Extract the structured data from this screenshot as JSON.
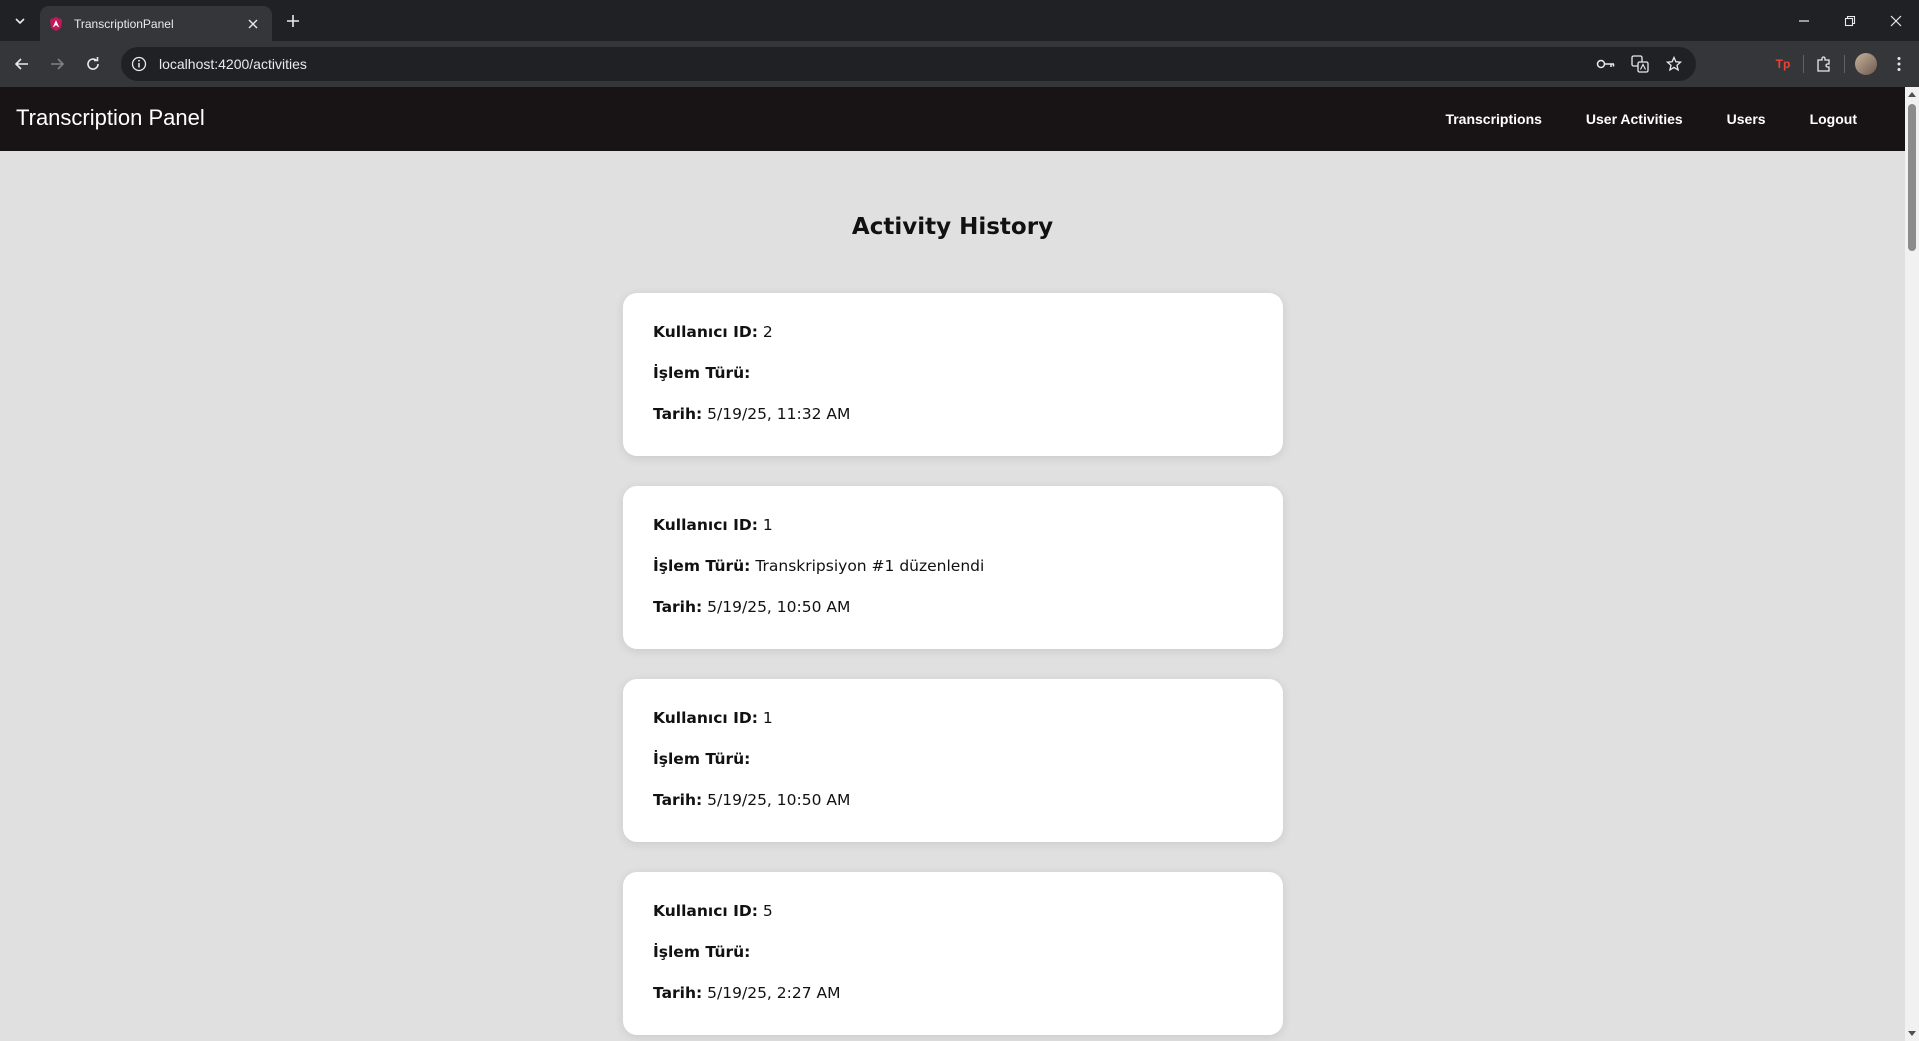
{
  "browser": {
    "tab_title": "TranscriptionPanel",
    "url": "localhost:4200/activities",
    "extension_badge": "Tp"
  },
  "header": {
    "brand": "Transcription Panel",
    "nav": [
      "Transcriptions",
      "User Activities",
      "Users",
      "Logout"
    ]
  },
  "page": {
    "title": "Activity History",
    "labels": {
      "user_id": "Kullanıcı ID:",
      "action_type": "İşlem Türü:",
      "date": "Tarih:"
    },
    "activities": [
      {
        "user_id": "2",
        "action_type": "",
        "date": "5/19/25, 11:32 AM"
      },
      {
        "user_id": "1",
        "action_type": "Transkripsiyon #1 düzenlendi",
        "date": "5/19/25, 10:50 AM"
      },
      {
        "user_id": "1",
        "action_type": "",
        "date": "5/19/25, 10:50 AM"
      },
      {
        "user_id": "5",
        "action_type": "",
        "date": "5/19/25, 2:27 AM"
      }
    ]
  },
  "colors": {
    "header_bg": "#181415",
    "page_bg": "#e0e0e0",
    "card_bg": "#ffffff",
    "chrome_bg": "#202124",
    "toolbar_bg": "#35363a"
  }
}
